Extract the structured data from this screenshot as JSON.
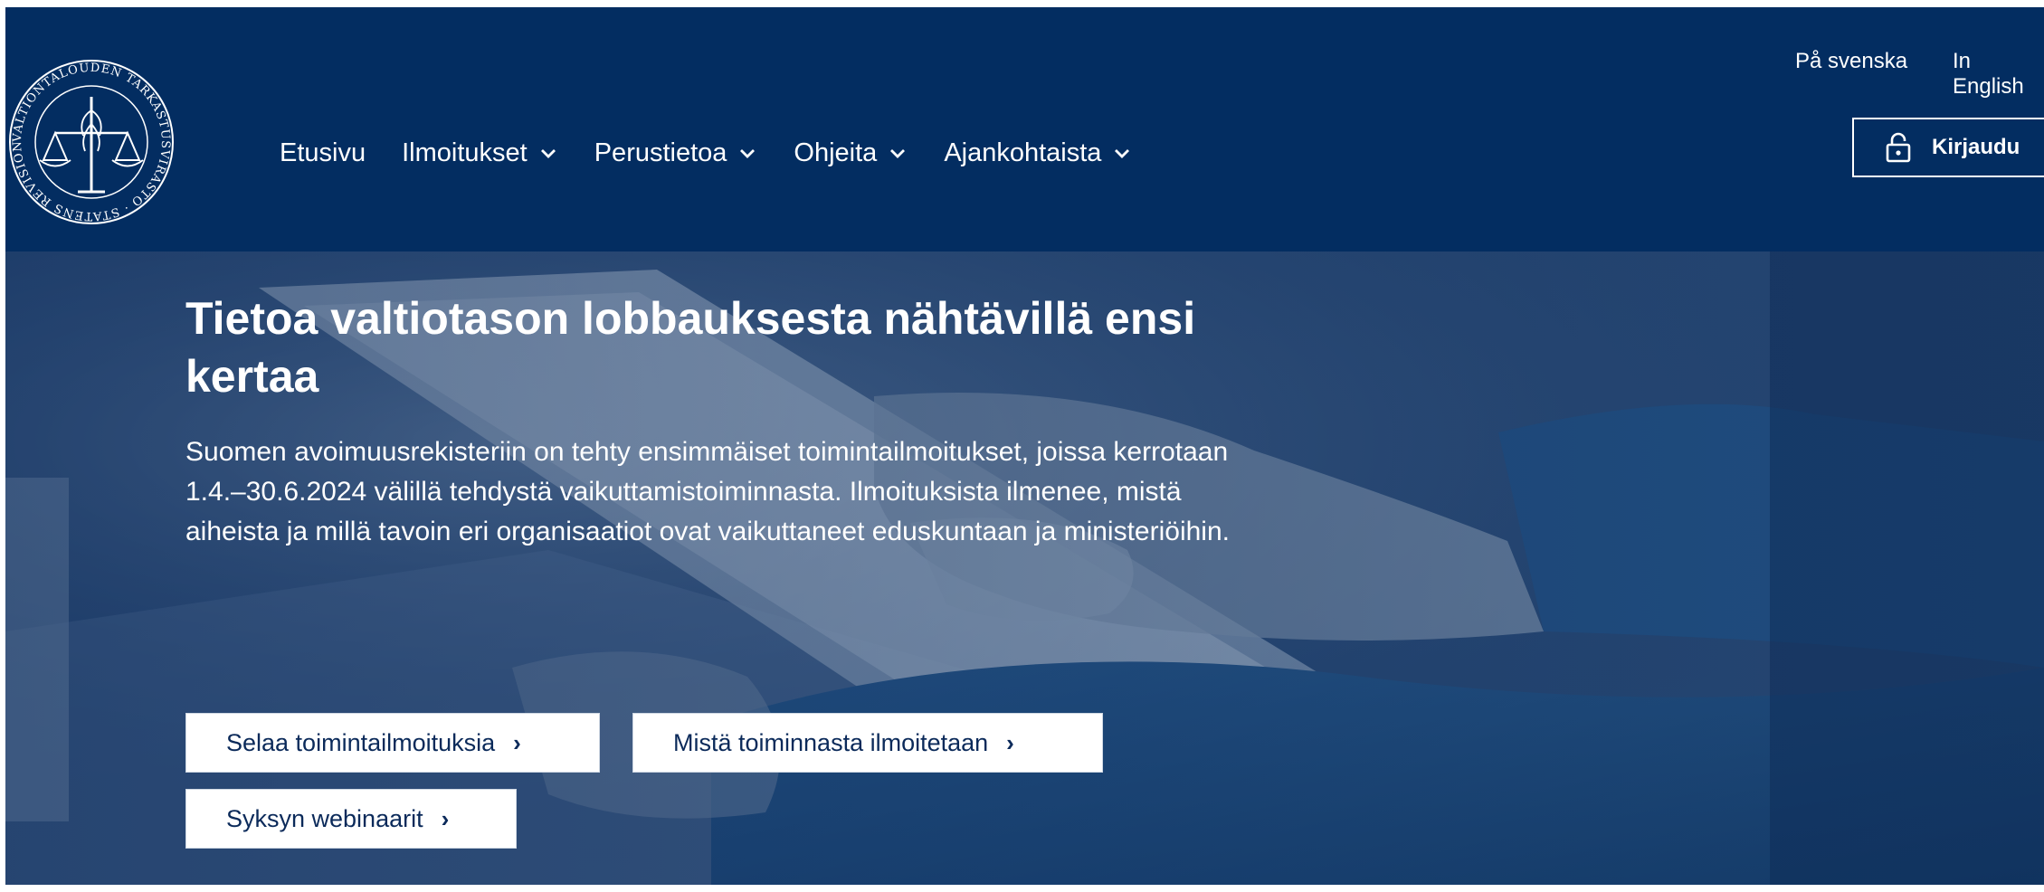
{
  "header": {
    "logo_text": "VALTIONTALOUDEN TARKASTUSVIRASTO · STATENS REVISIONSVERK",
    "nav": [
      {
        "label": "Etusivu",
        "dropdown": false
      },
      {
        "label": "Ilmoitukset",
        "dropdown": true
      },
      {
        "label": "Perustietoa",
        "dropdown": true
      },
      {
        "label": "Ohjeita",
        "dropdown": true
      },
      {
        "label": "Ajankohtaista",
        "dropdown": true
      }
    ],
    "lang_sv": "På svenska",
    "lang_en": "In English",
    "login_label": "Kirjaudu",
    "icons": {
      "dropdown": "chevron-down-icon",
      "login": "lock-icon"
    }
  },
  "hero": {
    "title": "Tietoa valtiotason lobbauksesta nähtävillä ensi kertaa",
    "lead": "Suomen avoimuusrekisteriin on tehty ensimmäiset toimintailmoitukset, joissa kerrotaan 1.4.–30.6.2024 välillä tehdystä vaikuttamistoiminnasta. Ilmoituksista ilmenee, mistä aiheista ja millä tavoin eri organisaatiot ovat vaikuttaneet eduskuntaan ja ministeriöihin.",
    "buttons": [
      {
        "label": "Selaa toimintailmoituksia",
        "arrow": "›"
      },
      {
        "label": "Mistä toiminnasta ilmoitetaan",
        "arrow": "›"
      },
      {
        "label": "Syksyn webinaarit",
        "arrow": "›"
      }
    ]
  },
  "colors": {
    "header_bg": "#032d61",
    "text_on_dark": "#ffffff",
    "button_text": "#0b2a5a"
  }
}
